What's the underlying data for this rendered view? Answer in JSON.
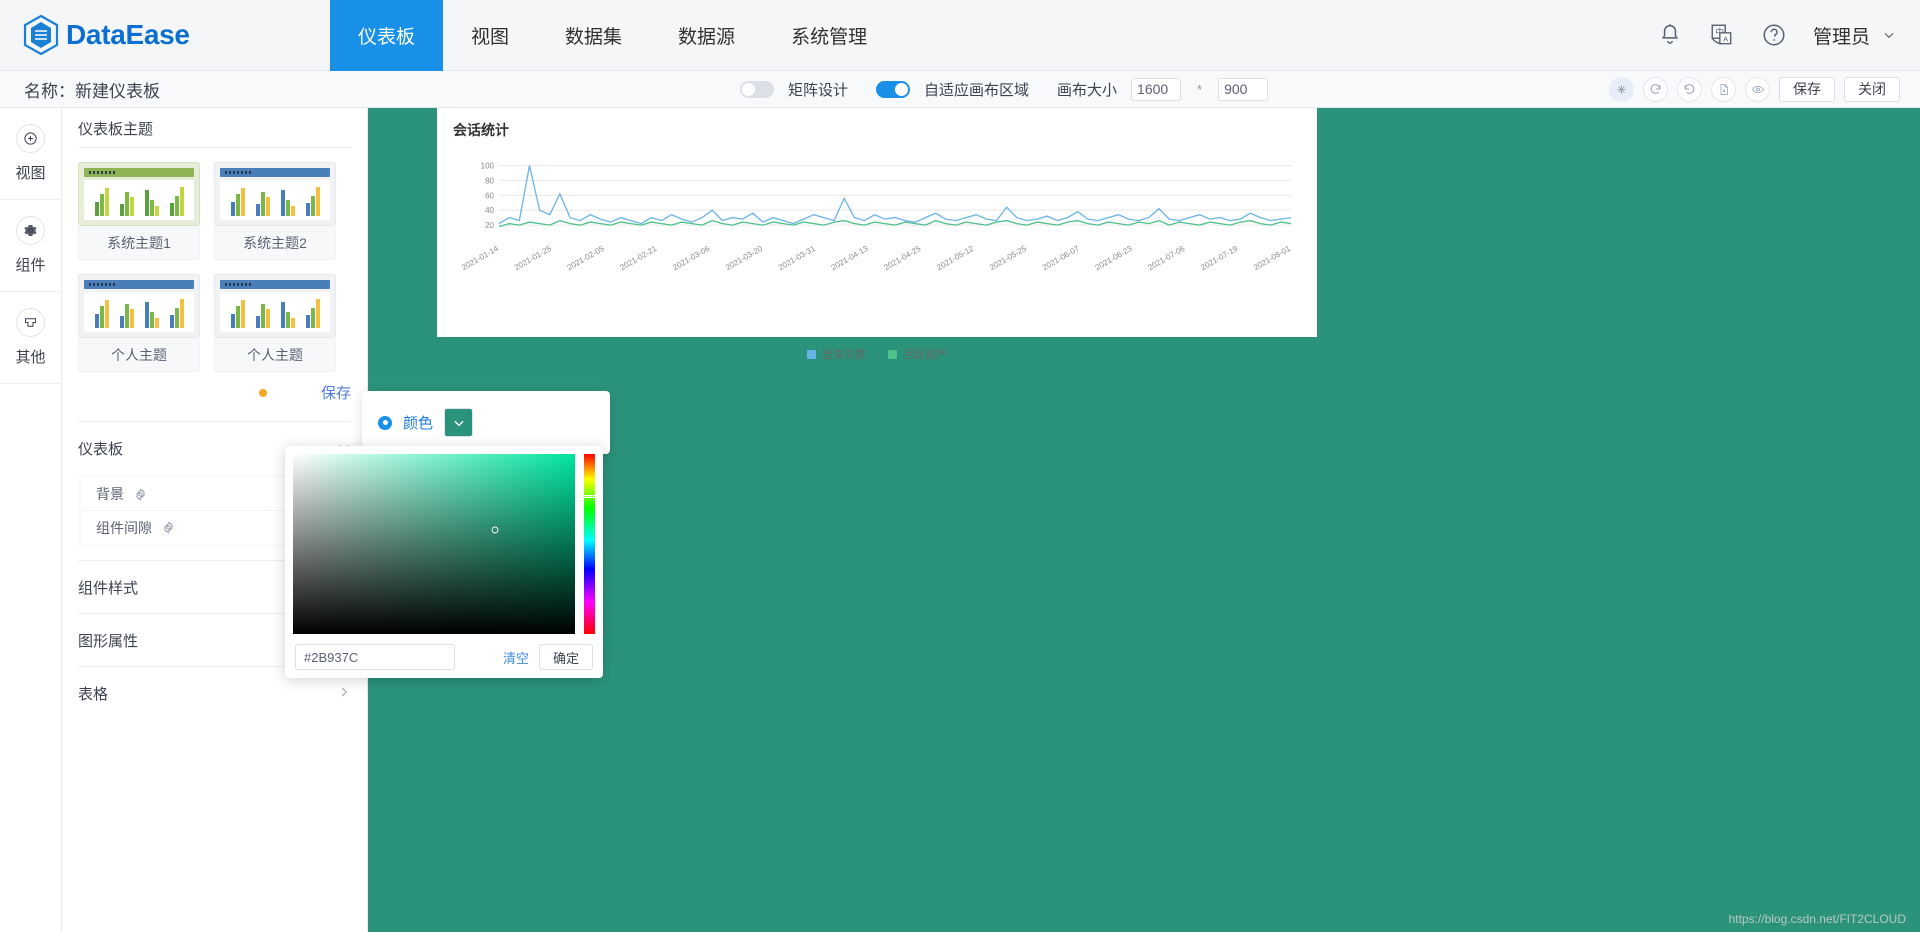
{
  "brand": {
    "name": "DataEase",
    "logo_icon": "hexagon-logo-icon"
  },
  "topnav": {
    "items": [
      {
        "label": "仪表板",
        "active": true
      },
      {
        "label": "视图",
        "active": false
      },
      {
        "label": "数据集",
        "active": false
      },
      {
        "label": "数据源",
        "active": false
      },
      {
        "label": "系统管理",
        "active": false
      }
    ],
    "right": {
      "bell_icon": "bell-icon",
      "language_icon": "language-icon",
      "help_icon": "help-circle-icon",
      "user_label": "管理员",
      "user_chevron": "chevron-down-icon"
    }
  },
  "toolbar": {
    "name_label": "名称：新建仪表板",
    "matrix_design_label": "矩阵设计",
    "matrix_design_on": false,
    "adaptive_label": "自适应画布区域",
    "adaptive_on": true,
    "canvas_size_label": "画布大小",
    "canvas_width": "1600",
    "canvas_multiply": "*",
    "canvas_height": "900",
    "icon_buttons": [
      {
        "name": "sparkle-icon",
        "glyph": "✳",
        "active": true
      },
      {
        "name": "redo-icon",
        "glyph": "↻",
        "active": false
      },
      {
        "name": "undo-icon",
        "glyph": "↺",
        "active": false
      },
      {
        "name": "export-file-icon",
        "glyph": "🗎",
        "active": false
      },
      {
        "name": "preview-eye-icon",
        "glyph": "◎",
        "active": false
      }
    ],
    "save_label": "保存",
    "close_label": "关闭"
  },
  "rail": {
    "items": [
      {
        "label": "视图",
        "icon": "plus-circle-icon"
      },
      {
        "label": "组件",
        "icon": "gear-icon"
      },
      {
        "label": "其他",
        "icon": "panel-icon"
      }
    ]
  },
  "panel": {
    "title": "仪表板主题",
    "themes": [
      {
        "name": "系统主题1",
        "selected": true,
        "header_color": "#8fb454",
        "bars": [
          "#5d9e3f",
          "#7db943",
          "#c4d63f"
        ]
      },
      {
        "name": "系统主题2",
        "selected": false,
        "header_color": "#4a7ebb",
        "bars": [
          "#4a7ebb",
          "#7ab648",
          "#f5bf42"
        ]
      },
      {
        "name": "个人主题",
        "selected": false,
        "header_color": "#4a7ebb",
        "bars": [
          "#4a7ebb",
          "#7ab648",
          "#f5bf42"
        ]
      },
      {
        "name": "个人主题",
        "selected": false,
        "header_color": "#4a7ebb",
        "bars": [
          "#4a7ebb",
          "#7ab648",
          "#f5bf42"
        ]
      }
    ],
    "theme_save_label": "保存",
    "sections": [
      {
        "title": "仪表板",
        "expanded": true,
        "rows": [
          "背景",
          "组件间隙"
        ]
      },
      {
        "title": "组件样式",
        "expanded": false,
        "rows": []
      },
      {
        "title": "图形属性",
        "expanded": false,
        "rows": []
      },
      {
        "title": "表格",
        "expanded": false,
        "rows": []
      }
    ]
  },
  "color_popover": {
    "label": "颜色",
    "radio_selected": true,
    "swatch_color": "#2B937C",
    "chevron_icon": "chevron-down-icon"
  },
  "color_picker": {
    "hex_value": "#2B937C",
    "clear_label": "清空",
    "confirm_label": "确定"
  },
  "canvas": {
    "background_color": "#2B937C",
    "watermark": "https://blog.csdn.net/FIT2CLOUD"
  },
  "chart_data": {
    "type": "line",
    "title": "会话统计",
    "xlabel": "",
    "ylabel": "",
    "ylim": [
      0,
      110
    ],
    "yticks": [
      20,
      40,
      60,
      80,
      100
    ],
    "grid": true,
    "legend_position": "bottom",
    "x": [
      "2021-01-14",
      "2021-01-25",
      "2021-02-05",
      "2021-02-21",
      "2021-03-06",
      "2021-03-20",
      "2021-03-31",
      "2021-04-13",
      "2021-04-25",
      "2021-05-12",
      "2021-05-25",
      "2021-06-07",
      "2021-06-23",
      "2021-07-06",
      "2021-07-19",
      "2021-08-01"
    ],
    "series": [
      {
        "name": "登录次数",
        "color": "#69b3e7",
        "values": [
          22,
          30,
          26,
          100,
          40,
          34,
          62,
          30,
          26,
          34,
          28,
          24,
          30,
          26,
          22,
          30,
          26,
          34,
          28,
          24,
          30,
          40,
          26,
          30,
          28,
          36,
          24,
          30,
          26,
          22,
          28,
          34,
          30,
          26,
          56,
          30,
          26,
          34,
          28,
          30,
          26,
          24,
          30,
          36,
          28,
          26,
          30,
          34,
          28,
          26,
          44,
          30,
          26,
          28,
          32,
          26,
          30,
          38,
          28,
          26,
          30,
          34,
          28,
          26,
          30,
          42,
          28,
          26,
          30,
          34,
          28,
          30,
          26,
          28,
          36,
          30,
          26,
          28,
          30
        ]
      },
      {
        "name": "活跃资产",
        "color": "#4ec08a",
        "values": [
          18,
          22,
          20,
          24,
          22,
          20,
          26,
          22,
          20,
          24,
          22,
          20,
          24,
          22,
          20,
          24,
          22,
          20,
          24,
          22,
          20,
          26,
          22,
          20,
          24,
          22,
          20,
          24,
          22,
          20,
          24,
          22,
          20,
          24,
          26,
          22,
          20,
          24,
          22,
          20,
          24,
          22,
          20,
          26,
          22,
          20,
          24,
          22,
          20,
          24,
          26,
          22,
          20,
          24,
          22,
          20,
          24,
          26,
          22,
          20,
          24,
          22,
          20,
          24,
          22,
          26,
          20,
          24,
          22,
          20,
          24,
          22,
          20,
          24,
          26,
          22,
          20,
          24,
          22
        ]
      }
    ]
  }
}
